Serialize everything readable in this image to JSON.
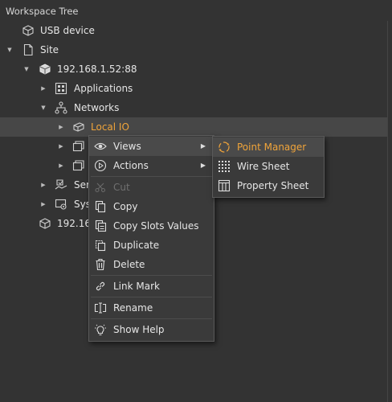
{
  "panel": {
    "title": "Workspace Tree"
  },
  "tree": {
    "usb": "USB device",
    "site": "Site",
    "host": "192.168.1.52:88",
    "applications": "Applications",
    "networks": "Networks",
    "local_io": "Local IO",
    "services_partial": "Ser",
    "system_partial": "Sys",
    "host2_partial": "192.16"
  },
  "context_menu": {
    "views": "Views",
    "actions": "Actions",
    "cut": "Cut",
    "copy": "Copy",
    "copy_slots": "Copy Slots Values",
    "duplicate": "Duplicate",
    "delete": "Delete",
    "link_mark": "Link Mark",
    "rename": "Rename",
    "show_help": "Show Help"
  },
  "views_submenu": {
    "point_manager": "Point Manager",
    "wire_sheet": "Wire Sheet",
    "property_sheet": "Property Sheet"
  },
  "colors": {
    "background": "#333333",
    "accent": "#f0a43a",
    "menu_bg": "#3a3a3a",
    "highlight": "#4a4a4a"
  }
}
